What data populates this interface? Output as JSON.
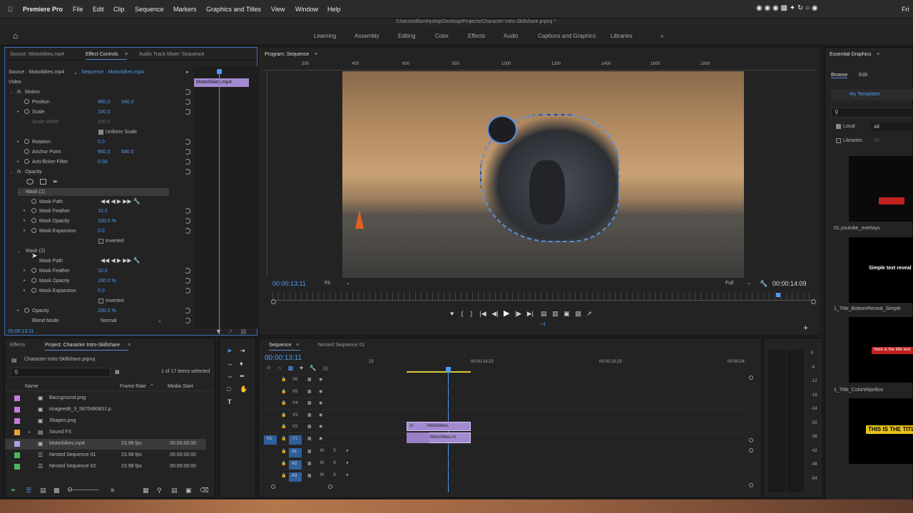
{
  "menubar": {
    "app": "Premiere Pro",
    "items": [
      "File",
      "Edit",
      "Clip",
      "Sequence",
      "Markers",
      "Graphics and Titles",
      "View",
      "Window",
      "Help"
    ],
    "clock": "Fri"
  },
  "titlebar": {
    "path": "/Users/williamhyslop/Desktop/Projects/Character Intro-Skillshare.prproj *"
  },
  "workspaces": [
    "Learning",
    "Assembly",
    "Editing",
    "Color",
    "Effects",
    "Audio",
    "Captions and Graphics",
    "Libraries"
  ],
  "effect_controls": {
    "tabs": [
      "Source: Motorbikes.mp4",
      "Effect Controls",
      "Audio Track Mixer: Sequence"
    ],
    "source_label": "Source · Motorbikes.mp4",
    "sequence_label": "Sequence · Motorbikes.mp4",
    "clip_name": "Motorbikes.mp4",
    "video_label": "Video",
    "motion": {
      "label": "Motion",
      "position_label": "Position",
      "position_x": "960.0",
      "position_y": "540.0",
      "scale_label": "Scale",
      "scale": "100.0",
      "scale_width_label": "Scale Width",
      "scale_width": "100.0",
      "uniform_label": "Uniform Scale",
      "rotation_label": "Rotation",
      "rotation": "0.0",
      "anchor_label": "Anchor Point",
      "anchor_x": "960.0",
      "anchor_y": "540.0",
      "flicker_label": "Anti-flicker Filter",
      "flicker": "0.00"
    },
    "opacity": {
      "label": "Opacity",
      "value": "100.0 %",
      "blend_label": "Blend Mode",
      "blend": "Normal"
    },
    "mask1": {
      "label": "Mask (1)",
      "path": "Mask Path",
      "feather_label": "Mask Feather",
      "feather": "10.0",
      "opacity_label": "Mask Opacity",
      "opacity": "100.0 %",
      "expansion_label": "Mask Expansion",
      "expansion": "0.0",
      "inverted": "Inverted"
    },
    "mask2": {
      "label": "Mask (2)",
      "path": "Mask Path",
      "feather_label": "Mask Feather",
      "feather": "10.0",
      "opacity_label": "Mask Opacity",
      "opacity": "100.0 %",
      "expansion_label": "Mask Expansion",
      "expansion": "0.0",
      "inverted": "Inverted"
    },
    "timecode": "00:00:13:11"
  },
  "program": {
    "title": "Program: Sequence",
    "ruler": [
      "200",
      "400",
      "600",
      "800",
      "1000",
      "1200",
      "1400",
      "1600",
      "1800"
    ],
    "timecode": "00:00:13:11",
    "fit": "Fit",
    "full": "Full",
    "duration": "00:00:14:09"
  },
  "essential": {
    "title": "Essential Graphics",
    "tabs": [
      "Browse",
      "Edit"
    ],
    "my_templates": "My Templates",
    "local": "Local",
    "all": "All",
    "libraries": "Libraries",
    "items": [
      "01.youtube_overlays",
      "1_Title_BottomReveal_Simple",
      "1_Title_ColorWipeBox"
    ],
    "thumb_text": [
      "Simple text reveal",
      "Here is the title text",
      "THIS IS THE TITLE"
    ]
  },
  "project": {
    "tabs": [
      "Effects",
      "Project: Character Intro-Skillshare"
    ],
    "file": "Character Intro-Skillshare.prproj",
    "count": "1 of 17 items selected",
    "columns": [
      "Name",
      "Frame Rate",
      "Media Start"
    ],
    "items": [
      {
        "name": "Baccground.png",
        "rate": "",
        "start": "",
        "color": "#c77ad8"
      },
      {
        "name": "imageedit_3_5870480831.p",
        "rate": "",
        "start": "",
        "color": "#c77ad8"
      },
      {
        "name": "Shapes.png",
        "rate": "",
        "start": "",
        "color": "#c77ad8"
      },
      {
        "name": "Sound FX",
        "rate": "",
        "start": "",
        "color": "#e6a531"
      },
      {
        "name": "Motorbikes.mp4",
        "rate": "23.98 fps",
        "start": "00:00:00:00",
        "color": "#a6a1e6"
      },
      {
        "name": "Nested Sequence 01",
        "rate": "23.98 fps",
        "start": "00:00:00:00",
        "color": "#4fb85f"
      },
      {
        "name": "Nested Sequence 02",
        "rate": "23.98 fps",
        "start": "00:00:00:00",
        "color": "#4fb85f"
      }
    ]
  },
  "timeline": {
    "tabs": [
      "Sequence",
      "Nested Sequence 01"
    ],
    "timecode": "00:00:13:11",
    "ruler": [
      "23",
      "00:00:14:23",
      "00:00:19:23",
      "00:00:24:"
    ],
    "video_tracks": [
      "V6",
      "V5",
      "V4",
      "V3",
      "V2",
      "V1"
    ],
    "audio_tracks": [
      "A1",
      "A2",
      "A3"
    ],
    "clip_v2": "Motorbikes.",
    "clip_v1": "Motorbikes.m",
    "src_v1": "V1",
    "meter_labels": [
      "0",
      "-6",
      "-12",
      "-18",
      "-24",
      "-30",
      "-36",
      "-42",
      "-48",
      "-54"
    ]
  }
}
